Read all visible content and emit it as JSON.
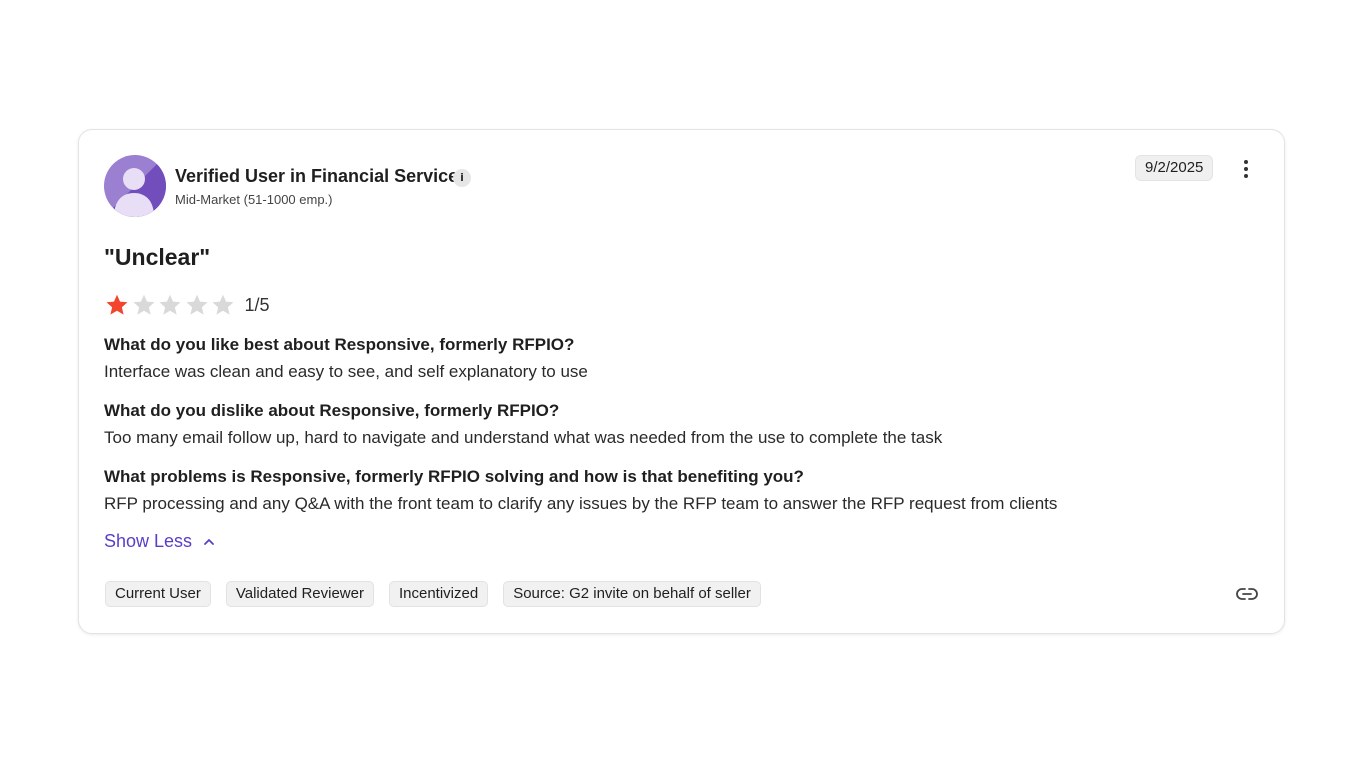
{
  "reviewer": {
    "name": "Verified User in Financial Services",
    "info_icon": "i",
    "segment": "Mid-Market (51-1000 emp.)",
    "avatar_icon": "user-avatar-icon"
  },
  "review": {
    "date": "9/2/2025",
    "title": "\"Unclear\"",
    "rating": 1,
    "rating_max": 5,
    "rating_text": "1/5",
    "qa": [
      {
        "question": "What do you like best about Responsive, formerly RFPIO?",
        "answer": "Interface was clean and easy to see, and self explanatory to use"
      },
      {
        "question": "What do you dislike about Responsive, formerly RFPIO?",
        "answer": "Too many email follow up, hard to navigate and understand what was needed from the use to complete the task"
      },
      {
        "question": "What problems is Responsive, formerly RFPIO solving and how is that benefiting you?",
        "answer": "RFP processing and any Q&A with the front team to clarify any issues by the RFP team to answer the RFP request from clients"
      }
    ],
    "show_less_label": "Show Less",
    "tags": [
      "Current User",
      "Validated Reviewer",
      "Incentivized",
      "Source: G2 invite on behalf of seller"
    ]
  },
  "icons": {
    "more": "more-vertical-icon",
    "chevron": "chevron-up-icon",
    "link": "link-icon",
    "star_filled": "star-filled-icon",
    "star_empty": "star-empty-icon"
  },
  "colors": {
    "star_filled": "#f2452e",
    "star_empty": "#d9d9d9",
    "accent": "#5a3ec8",
    "avatar_bg": "#9b7fd1",
    "avatar_figure": "#e8def5"
  }
}
